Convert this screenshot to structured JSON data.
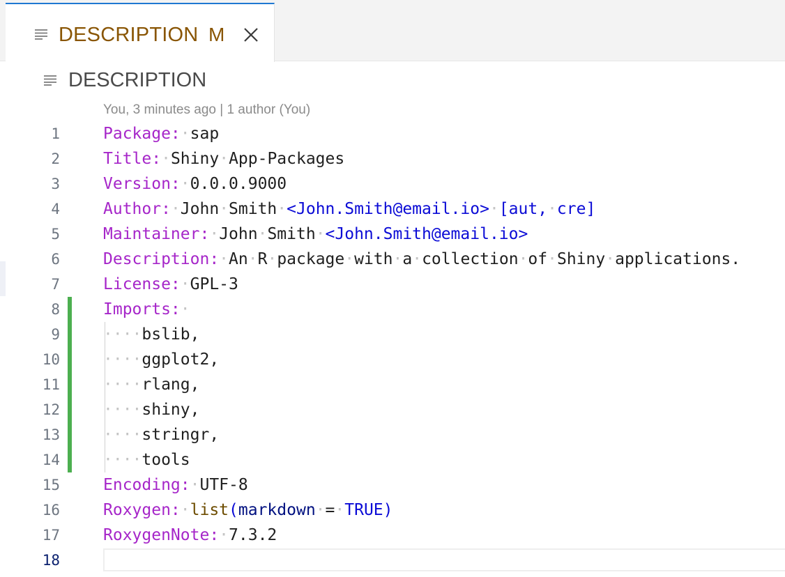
{
  "tab": {
    "label": "DESCRIPTION",
    "badge": "M",
    "icon": "lines-icon",
    "close_icon": "close-icon"
  },
  "breadcrumb": {
    "label": "DESCRIPTION",
    "icon": "lines-icon"
  },
  "blame": "You, 3 minutes ago | 1 author (You)",
  "colors": {
    "key": "#a626c9",
    "link": "#0b0bd6",
    "modified_gutter": "#4caf50",
    "tab_text": "#895503"
  },
  "lines": [
    {
      "n": "1",
      "key": "Package:",
      "value": "sap"
    },
    {
      "n": "2",
      "key": "Title:",
      "value": "Shiny App-Packages"
    },
    {
      "n": "3",
      "key": "Version:",
      "value": "0.0.0.9000"
    },
    {
      "n": "4",
      "key": "Author:",
      "value": "John Smith",
      "email": "<John.Smith@email.io>",
      "roles": "[aut, cre]"
    },
    {
      "n": "5",
      "key": "Maintainer:",
      "value": "John Smith",
      "email": "<John.Smith@email.io>"
    },
    {
      "n": "6",
      "key": "Description:",
      "value": "An R package with a collection of Shiny applications."
    },
    {
      "n": "7",
      "key": "License:",
      "value": "GPL-3"
    },
    {
      "n": "8",
      "key": "Imports:",
      "value": ""
    },
    {
      "n": "9",
      "value": "bslib,"
    },
    {
      "n": "10",
      "value": "ggplot2,"
    },
    {
      "n": "11",
      "value": "rlang,"
    },
    {
      "n": "12",
      "value": "shiny,"
    },
    {
      "n": "13",
      "value": "stringr,"
    },
    {
      "n": "14",
      "value": "tools"
    },
    {
      "n": "15",
      "key": "Encoding:",
      "value": "UTF-8"
    },
    {
      "n": "16",
      "key": "Roxygen:",
      "fn": "list",
      "arg": "markdown",
      "op": "=",
      "lit": "TRUE"
    },
    {
      "n": "17",
      "key": "RoxygenNote:",
      "value": "7.3.2"
    },
    {
      "n": "18"
    }
  ]
}
